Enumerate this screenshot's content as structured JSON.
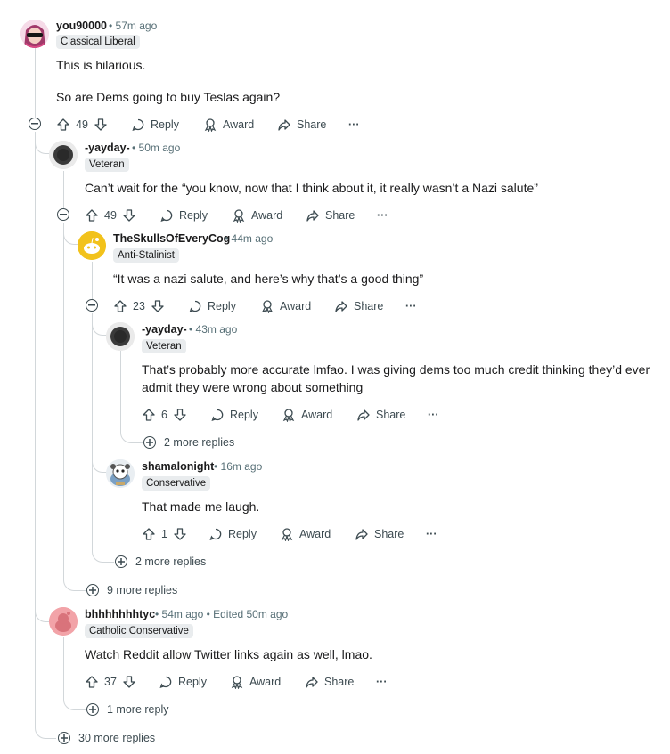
{
  "actions": {
    "reply": "Reply",
    "award": "Award",
    "share": "Share",
    "more": "···"
  },
  "comments": [
    {
      "username": "you90000",
      "time": "57m ago",
      "flair": "Classical Liberal",
      "body": [
        "This is hilarious.",
        "So are Dems going to buy Teslas again?"
      ],
      "score": "49"
    },
    {
      "username": "-yayday-",
      "time": "50m ago",
      "flair": "Veteran",
      "body": [
        "Can’t wait for the “you know, now that I think about it, it really wasn’t a Nazi salute”"
      ],
      "score": "49"
    },
    {
      "username": "TheSkullsOfEveryCog",
      "time": "44m ago",
      "flair": "Anti-Stalinist",
      "body": [
        "“It was a nazi salute, and here’s why that’s a good thing”"
      ],
      "score": "23"
    },
    {
      "username": "-yayday-",
      "time": "43m ago",
      "flair": "Veteran",
      "body": [
        "That’s probably more accurate lmfao. I was giving dems too much credit thinking they’d ever",
        "admit they were wrong about something"
      ],
      "score": "6"
    },
    {
      "username": "shamalonight",
      "time": "16m ago",
      "flair": "Conservative",
      "body": [
        "That made me laugh."
      ],
      "score": "1"
    },
    {
      "username": "bhhhhhhhtyc",
      "time": "54m ago",
      "edited": "Edited 50m ago",
      "flair": "Catholic Conservative",
      "body": [
        "Watch Reddit allow Twitter links again as well, lmao."
      ],
      "score": "37"
    }
  ],
  "more_replies": [
    "2 more replies",
    "2 more replies",
    "9 more replies",
    "1 more reply",
    "30 more replies"
  ],
  "colors": {
    "text": "#1a1a1b",
    "meta": "#576f76",
    "flair_bg": "#e9ecee",
    "thread_line": "#d2d7da",
    "action": "#3c4a50"
  }
}
